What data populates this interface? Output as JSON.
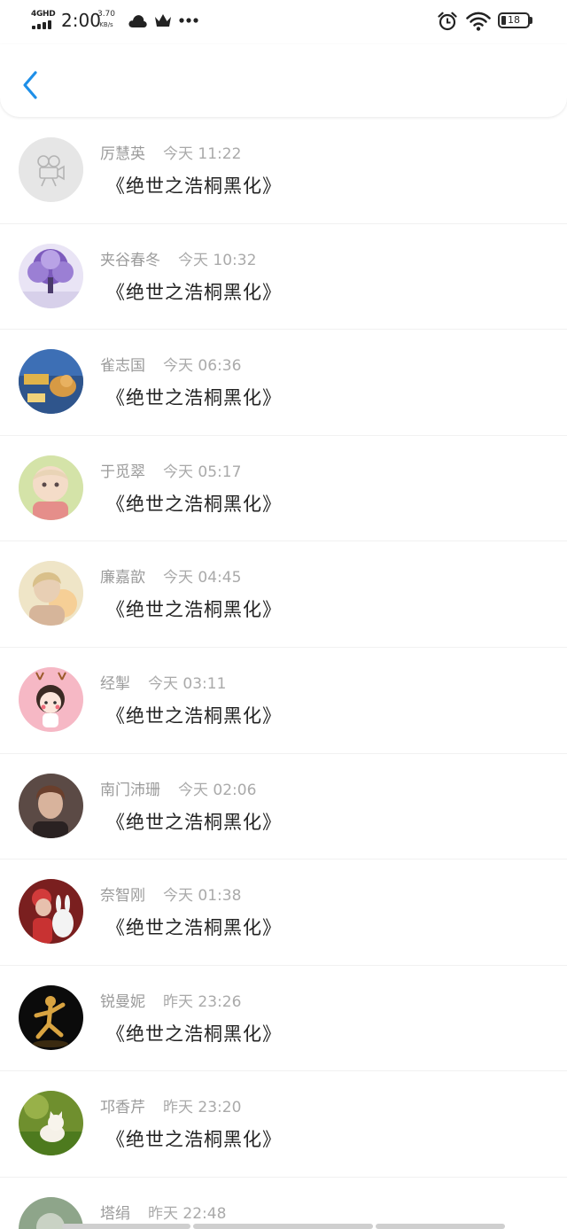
{
  "status_bar": {
    "network": "4GHD",
    "time": "2:00",
    "speed_value": "3.70",
    "speed_unit": "KB/s",
    "battery": "18",
    "icons": [
      "signal-icon",
      "cloud-icon",
      "crown-icon",
      "more-icon",
      "alarm-icon",
      "wifi-icon",
      "battery-icon"
    ]
  },
  "header": {
    "back_icon": "chevron-left-icon",
    "accent_color": "#1e8fe8"
  },
  "messages": [
    {
      "name": "厉慧英",
      "time": "今天 11:22",
      "text": "《绝世之浩桐黑化》",
      "avatar": "camera-placeholder"
    },
    {
      "name": "夹谷春冬",
      "time": "今天 10:32",
      "text": "《绝世之浩桐黑化》",
      "avatar": "purple-tree"
    },
    {
      "name": "雀志国",
      "time": "今天 06:36",
      "text": "《绝世之浩桐黑化》",
      "avatar": "cartoon-dog"
    },
    {
      "name": "于觅翠",
      "time": "今天 05:17",
      "text": "《绝世之浩桐黑化》",
      "avatar": "anime-child"
    },
    {
      "name": "廉嘉歆",
      "time": "今天 04:45",
      "text": "《绝世之浩桐黑化》",
      "avatar": "blonde-girl"
    },
    {
      "name": "经掣",
      "time": "今天 03:11",
      "text": "《绝世之浩桐黑化》",
      "avatar": "pink-deer-girl"
    },
    {
      "name": "南门沛珊",
      "time": "今天 02:06",
      "text": "《绝世之浩桐黑化》",
      "avatar": "cg-boy"
    },
    {
      "name": "奈智刚",
      "time": "今天 01:38",
      "text": "《绝世之浩桐黑化》",
      "avatar": "girl-with-rabbit"
    },
    {
      "name": "锐曼妮",
      "time": "昨天 23:26",
      "text": "《绝世之浩桐黑化》",
      "avatar": "golden-dancer"
    },
    {
      "name": "邛香芹",
      "time": "昨天 23:20",
      "text": "《绝世之浩桐黑化》",
      "avatar": "white-kitten"
    },
    {
      "name": "塔绢",
      "time": "昨天 22:48",
      "text": "",
      "avatar": "dandelion"
    }
  ]
}
